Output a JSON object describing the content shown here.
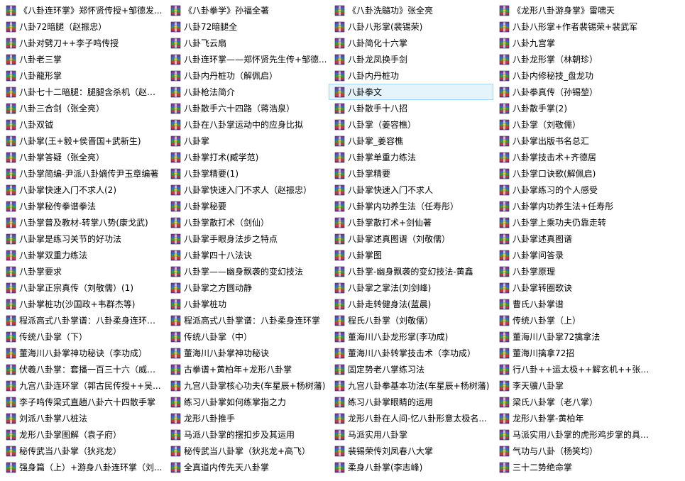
{
  "files": {
    "icon": "rar-archive-icon",
    "selected_column": 2,
    "selected_row": 5,
    "columns": [
      [
        "《八卦连环掌》郑怀贤传授+邹德发...",
        "八卦72暗腿（赵振忠）",
        "八卦对劈刀++李子鸣传授",
        "八卦老三掌",
        "八卦龍形掌",
        "八卦七十二暗腿：腿腿含杀机（赵振...",
        "八卦三合剑（张全亮）",
        "八卦双钺",
        "八卦掌(王+毅+侯晋国+武新生)",
        "八卦掌答疑（张全亮）",
        "八卦掌简编-尹派八卦嫡传尹玉章编著",
        "八卦掌快速入门不求人(2)",
        "八卦掌秘传拳谱拳法",
        "八卦掌普及教材-转掌八势(康戈武)",
        "八卦掌是练习关节的好功法",
        "八卦掌双重力练法",
        "八卦掌要求",
        "八卦掌正宗真传（刘敬儒）(1)",
        "八卦掌桩功(沙国政+韦群杰等)",
        "程派高式八卦掌谱：八卦柔身连环掌...",
        "传统八卦掌（下）",
        "董海川八卦掌神功秘诀（李功成）",
        "伏羲八卦掌：套播一百三十六（威晨...",
        "九宫八卦连环掌（郭古民传授++吴...",
        "李子鸣传梁式直趟八卦六十四散手掌",
        "刘派八卦掌八桩法",
        "龙形八卦掌图解（袁子府）",
        "秘传武当八卦掌（狄兆龙）",
        "强身篇（上）+游身八卦连环掌（刘..."
      ],
      [
        "《八卦拳学》孙福全著",
        "八卦72暗腿全",
        "八卦飞云扇",
        "八卦连环掌——郑怀贤先生传+邹德...",
        "八卦内丹桩功（解佩启）",
        "八卦枪法简介",
        "八卦散手六十四路（蒋浩泉）",
        "八卦在八卦掌运动中的应身比拟",
        "八卦掌",
        "八卦掌打术(臧学范)",
        "八卦掌精要(1)",
        "八卦掌快速入门不求人（赵振忠）",
        "八卦掌秘要",
        "八卦掌散打术（剑仙）",
        "八卦掌手眼身法步之特点",
        "八卦掌四十八法诀",
        "八卦掌——幽身飘袭的变幻技法",
        "八卦掌之方圆动静",
        "八卦掌桩功",
        "程派高式八卦掌谱：八卦柔身连环掌",
        "传统八卦掌（中）",
        "董海川八卦掌神功秘诀",
        "古拳谱+黄柏年+龙形八卦掌",
        "九宫八卦掌核心功夫(车星辰+杨树藩)",
        "练习八卦掌如何练掌指之力",
        "龙形八卦推手",
        "马派八卦掌的摆扣步及其运用",
        "秘传武当八卦掌（狄兆龙+高飞）",
        "全真道内传先天八卦掌"
      ],
      [
        "《八卦洗髓功》张全亮",
        "八卦八形掌(裴锡荣)",
        "八卦简化十六掌",
        "八卦龙凤换手剑",
        "八卦内丹桩功",
        "八卦拳文",
        "八卦散手十八招",
        "八卦掌（姜容樵）",
        "八卦掌_姜容樵",
        "八卦掌单重力练法",
        "八卦掌精要",
        "八卦掌快速入门不求人",
        "八卦掌内功养生法（任寿彤）",
        "八卦掌散打术+剑仙著",
        "八卦掌述真图谱（刘敬儒）",
        "八卦掌图",
        "八卦掌-幽身飘袭的变幻技法-黄鑫",
        "八卦掌之掌法(刘剑峰)",
        "八卦走转健身法(蓝晨)",
        "程氏八卦掌（刘敬儒）",
        "董海川八卦龙形掌(李功成)",
        "董海川八卦转掌技击术（李功成）",
        "固定势老八掌练习法",
        "九宫八卦拳基本功法(车星辰+杨树藩)",
        "练习八卦掌眼睛的运用",
        "龙形八卦在人间-忆八卦形意太极名...",
        "马派实用八卦掌",
        "裴锡荣传刘凤春八大掌",
        "柔身八卦掌(李志峰)"
      ],
      [
        "《龙形八卦游身掌》雷啸天",
        "八卦八形掌+作者裴锡荣+裴武军",
        "八卦九宫掌",
        "八卦龙形掌（林朝珍）",
        "八卦内修秘技_盘龙功",
        "八卦拳真传（孙锡堃）",
        "八卦散手掌(2)",
        "八卦掌（刘敬儒）",
        "八卦掌出版书名总汇",
        "八卦掌技击术+齐德居",
        "八卦掌口诀歌(解佩启)",
        "八卦掌练习的个人感受",
        "八卦掌内功养生法+任寿彤",
        "八卦掌上乘功夫仍靠走转",
        "八卦掌述真图谱",
        "八卦掌问答录",
        "八卦掌原理",
        "八卦掌转圈歌诀",
        "曹氏八卦掌谱",
        "传统八卦掌（上）",
        "董海川八卦掌72擒拿法",
        "董海川擒拿72招",
        "行八卦++运太极++解玄机++张全...",
        "李天骥八卦掌",
        "梁氏八卦掌（老八掌）",
        "龙形八卦掌-黄柏年",
        "马派实用八卦掌的虎形鸡步掌的具体...",
        "气功与八卦（杨笑均）",
        "三十二势绝命掌"
      ]
    ]
  }
}
